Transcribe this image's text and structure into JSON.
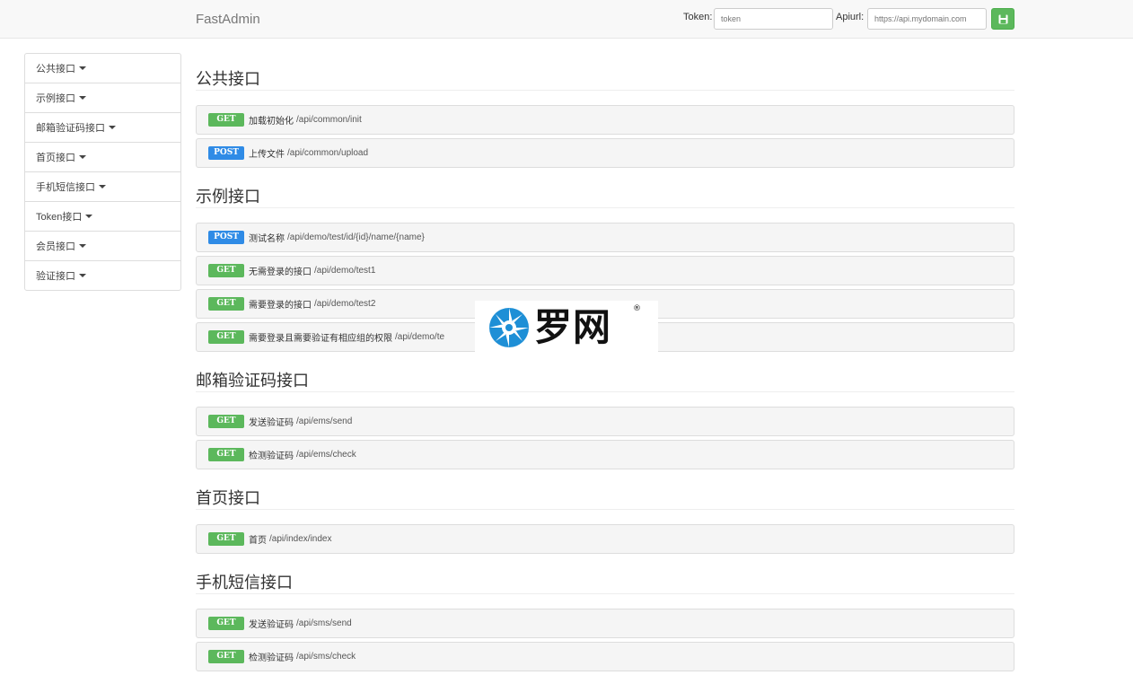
{
  "header": {
    "brand": "FastAdmin",
    "token_label": "Token:",
    "token_placeholder": "token",
    "apiurl_label": "Apiurl:",
    "apiurl_placeholder": "https://api.mydomain.com"
  },
  "sidebar": {
    "items": [
      {
        "label": "公共接口"
      },
      {
        "label": "示例接口"
      },
      {
        "label": "邮箱验证码接口"
      },
      {
        "label": "首页接口"
      },
      {
        "label": "手机短信接口"
      },
      {
        "label": "Token接口"
      },
      {
        "label": "会员接口"
      },
      {
        "label": "验证接口"
      }
    ]
  },
  "sections": [
    {
      "title": "公共接口",
      "apis": [
        {
          "method": "GET",
          "name": "加载初始化",
          "path": "/api/common/init"
        },
        {
          "method": "POST",
          "name": "上传文件",
          "path": "/api/common/upload"
        }
      ]
    },
    {
      "title": "示例接口",
      "apis": [
        {
          "method": "POST",
          "name": "测试名称",
          "path": "/api/demo/test/id/{id}/name/{name}"
        },
        {
          "method": "GET",
          "name": "无需登录的接口",
          "path": "/api/demo/test1"
        },
        {
          "method": "GET",
          "name": "需要登录的接口",
          "path": "/api/demo/test2"
        },
        {
          "method": "GET",
          "name": "需要登录且需要验证有相应组的权限",
          "path": "/api/demo/te"
        }
      ]
    },
    {
      "title": "邮箱验证码接口",
      "apis": [
        {
          "method": "GET",
          "name": "发送验证码",
          "path": "/api/ems/send"
        },
        {
          "method": "GET",
          "name": "检测验证码",
          "path": "/api/ems/check"
        }
      ]
    },
    {
      "title": "首页接口",
      "apis": [
        {
          "method": "GET",
          "name": "首页",
          "path": "/api/index/index"
        }
      ]
    },
    {
      "title": "手机短信接口",
      "apis": [
        {
          "method": "GET",
          "name": "发送验证码",
          "path": "/api/sms/send"
        },
        {
          "method": "GET",
          "name": "检测验证码",
          "path": "/api/sms/check"
        }
      ]
    }
  ],
  "watermark": {
    "text": "罗网",
    "registered": "®"
  },
  "colors": {
    "get_badge": "#5cb85c",
    "post_badge": "#2f8be6",
    "save_button": "#5cb85c"
  },
  "icons": {
    "save": "floppy-disk-icon",
    "caret": "caret-down-icon",
    "watermark_logo": "spiral-logo-icon"
  }
}
